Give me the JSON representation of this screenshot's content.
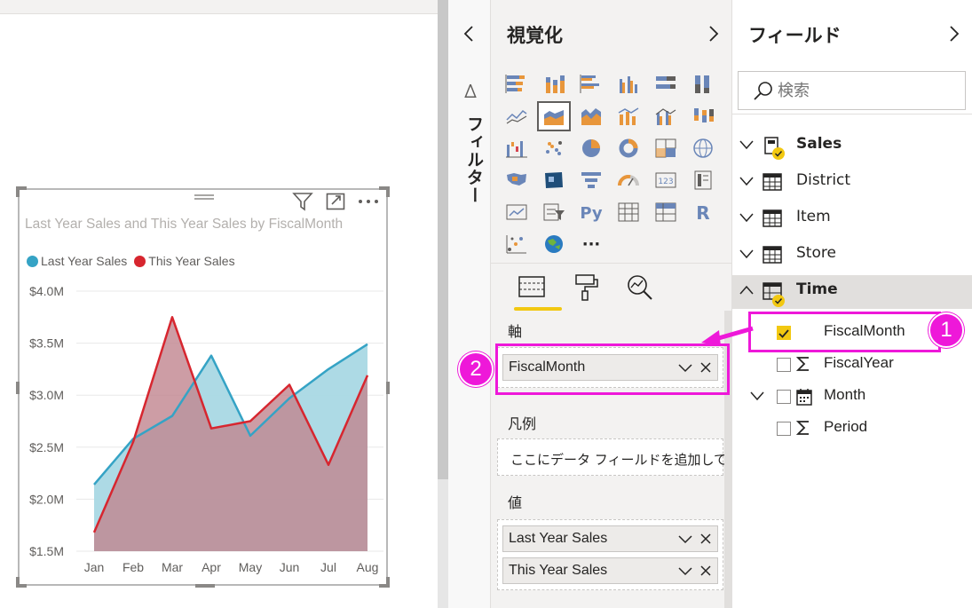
{
  "chart_data": {
    "type": "area",
    "title": "Last Year Sales and This Year Sales by FiscalMonth",
    "categories": [
      "Jan",
      "Feb",
      "Mar",
      "Apr",
      "May",
      "Jun",
      "Jul",
      "Aug"
    ],
    "series": [
      {
        "name": "Last Year Sales",
        "color": "#35a3c5",
        "fill": "#a9d8e4",
        "values": [
          2.14,
          2.58,
          2.8,
          3.38,
          2.61,
          2.97,
          3.25,
          3.49
        ]
      },
      {
        "name": "This Year Sales",
        "color": "#d7262f",
        "fill": "#c0858e",
        "values": [
          1.68,
          2.55,
          3.75,
          2.68,
          2.75,
          3.1,
          2.33,
          3.19
        ]
      }
    ],
    "y_ticks": [
      "$1.5M",
      "$2.0M",
      "$2.5M",
      "$3.0M",
      "$3.5M",
      "$4.0M"
    ],
    "y_tick_values": [
      1.5,
      2.0,
      2.5,
      3.0,
      3.5,
      4.0
    ],
    "ylim": [
      1.5,
      4.0
    ],
    "grid": true,
    "legend": "top-left"
  },
  "filter_pane": {
    "label": "フィルター"
  },
  "viz_pane": {
    "title": "視覚化",
    "more_label": "···",
    "wells": {
      "axis": {
        "label": "軸",
        "fields": [
          "FiscalMonth"
        ]
      },
      "legend": {
        "label": "凡例",
        "placeholder": "ここにデータ フィールドを追加して..."
      },
      "values": {
        "label": "値",
        "fields": [
          "Last Year Sales",
          "This Year Sales"
        ]
      }
    }
  },
  "fields_pane": {
    "title": "フィールド",
    "search_placeholder": "検索",
    "tables": [
      {
        "name": "Sales",
        "bold": true,
        "expanded": false
      },
      {
        "name": "District",
        "bold": false,
        "expanded": false
      },
      {
        "name": "Item",
        "bold": false,
        "expanded": false
      },
      {
        "name": "Store",
        "bold": false,
        "expanded": false
      },
      {
        "name": "Time",
        "bold": true,
        "expanded": true
      }
    ],
    "time_fields": [
      {
        "name": "FiscalMonth",
        "checked": true,
        "icon": "none"
      },
      {
        "name": "FiscalYear",
        "checked": false,
        "icon": "sigma-icon"
      },
      {
        "name": "Month",
        "checked": false,
        "icon": "calendar-icon"
      },
      {
        "name": "Period",
        "checked": false,
        "icon": "sigma-icon"
      }
    ]
  },
  "annotations": {
    "step1": "1",
    "step2": "2",
    "color": "#ee18d9"
  }
}
